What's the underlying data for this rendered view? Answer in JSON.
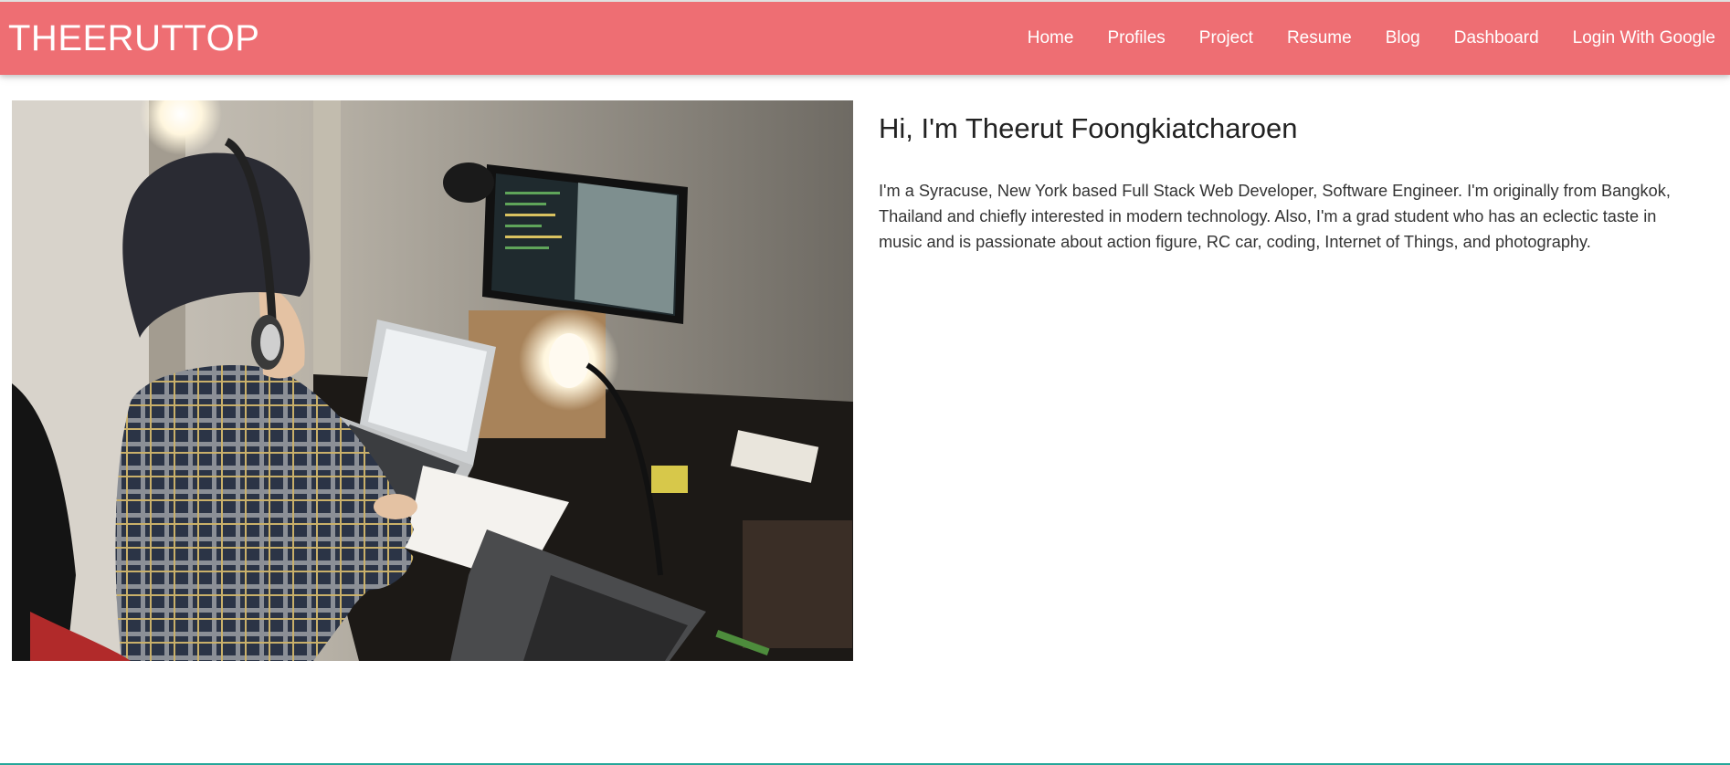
{
  "navbar": {
    "brand": "THEERUTTOP",
    "links": [
      {
        "label": "Home"
      },
      {
        "label": "Profiles"
      },
      {
        "label": "Project"
      },
      {
        "label": "Resume"
      },
      {
        "label": "Blog"
      },
      {
        "label": "Dashboard"
      },
      {
        "label": "Login With Google"
      }
    ],
    "color": "#ee6e73"
  },
  "intro": {
    "title": "Hi, I'm Theerut Foongkiatcharoen",
    "text": "I'm a Syracuse, New York based Full Stack Web Developer, Software Engineer. I'm originally from Bangkok, Thailand and chiefly interested in modern technology. Also, I'm a grad student who has an eclectic taste in music and is passionate about action figure, RC car, coding, Internet of Things, and photography."
  }
}
